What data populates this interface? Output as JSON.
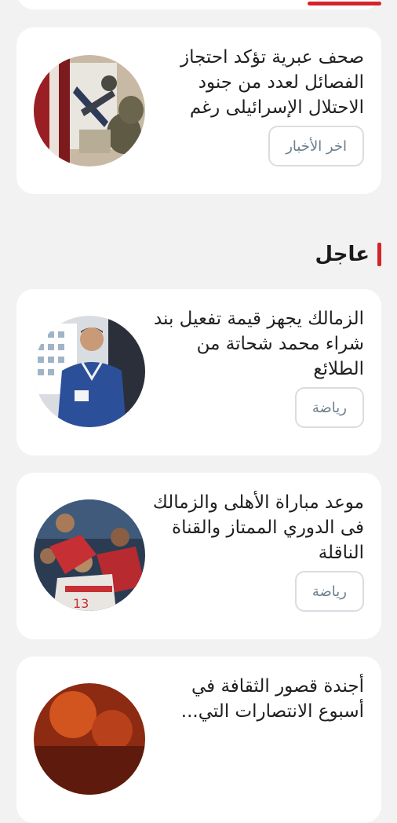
{
  "section": {
    "title": "عاجل"
  },
  "articles": [
    {
      "title": "صحف عبرية تؤكد احتجاز الفصائل لعدد من جنود الاحتلال الإسرائيلى رغم نفى...",
      "tag": "اخر الأخبار",
      "image": "soldiers-photo"
    },
    {
      "title": "الزمالك يجهز قيمة تفعيل بند شراء محمد شحاتة من الطلائع",
      "tag": "رياضة",
      "image": "player-photo"
    },
    {
      "title": "موعد مباراة الأهلى والزمالك فى الدوري الممتاز والقناة الناقلة",
      "tag": "رياضة",
      "image": "team-celebration-photo"
    },
    {
      "title": "أجندة قصور الثقافة في أسبوع الانتصارات التي...",
      "tag": "",
      "image": "event-photo"
    }
  ],
  "colors": {
    "accent": "#d6232b",
    "card": "#ffffff",
    "background": "#f2f2f2",
    "tag_text": "#6d7e8c"
  }
}
